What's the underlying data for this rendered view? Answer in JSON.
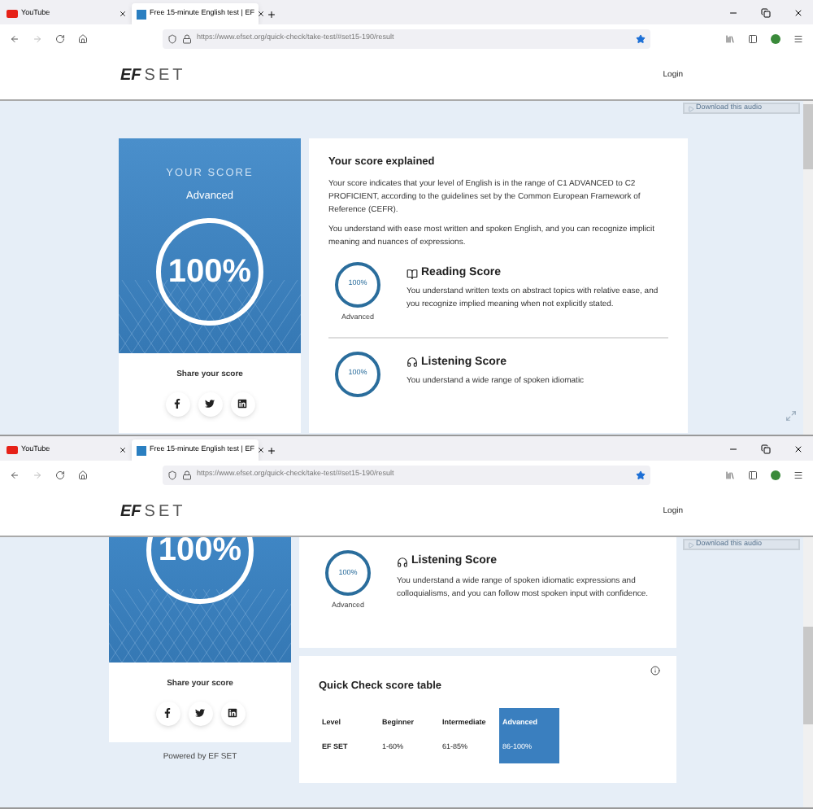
{
  "windows": [
    {
      "kind": "top",
      "tabs": [
        {
          "label": "YouTube",
          "kind": "youtube",
          "selected": false
        },
        {
          "label": "Free 15-minute English test | EF",
          "kind": "efset",
          "selected": true
        }
      ],
      "url": "https://www.efset.org/quick-check/take-test/#set15-190/result",
      "logo": {
        "bold": "EF",
        "light": "SET"
      },
      "login": "Login",
      "audio_hint": "Download this audio",
      "score_card": {
        "heading": "YOUR SCORE",
        "level": "Advanced",
        "score": "100%",
        "share_label": "Share your score"
      },
      "explained": {
        "title": "Your score explained",
        "paragraphs": [
          "Your score indicates that your level of English is in the range of C1 ADVANCED to C2 PROFICIENT, according to the guidelines set by the Common European Framework of Reference (CEFR).",
          "You understand with ease most written and spoken English, and you can recognize implicit meaning and nuances of expressions."
        ]
      },
      "skills": [
        {
          "kind": "reading",
          "title": "Reading Score",
          "score": "100%",
          "level": "Advanced",
          "text": "You understand written texts on abstract topics with relative ease, and you recognize implied meaning when not explicitly stated."
        },
        {
          "kind": "listening",
          "title": "Listening Score",
          "score": "100%",
          "text": "You understand a wide range of spoken idiomatic"
        }
      ]
    },
    {
      "kind": "bottom",
      "tabs": [
        {
          "label": "YouTube",
          "kind": "youtube",
          "selected": false
        },
        {
          "label": "Free 15-minute English test | EF",
          "kind": "efset",
          "selected": true
        }
      ],
      "url": "https://www.efset.org/quick-check/take-test/#set15-190/result",
      "logo": {
        "bold": "EF",
        "light": "SET"
      },
      "login": "Login",
      "audio_hint": "Download this audio",
      "score_card": {
        "score": "100%",
        "share_label": "Share your score",
        "powered_by": "Powered by EF SET"
      },
      "skills": [
        {
          "kind": "listening",
          "title": "Listening Score",
          "score": "100%",
          "level": "Advanced",
          "text": "You understand a wide range of spoken idiomatic expressions and colloquialisms, and you can follow most spoken input with confidence."
        }
      ],
      "score_table": {
        "title": "Quick Check score table",
        "columns": [
          {
            "header": "Level",
            "value": "EF SET",
            "selected": false
          },
          {
            "header": "Beginner",
            "value": "1-60%",
            "selected": false
          },
          {
            "header": "Intermediate",
            "value": "61-85%",
            "selected": false
          },
          {
            "header": "Advanced",
            "value": "86-100%",
            "selected": true
          }
        ]
      }
    }
  ]
}
